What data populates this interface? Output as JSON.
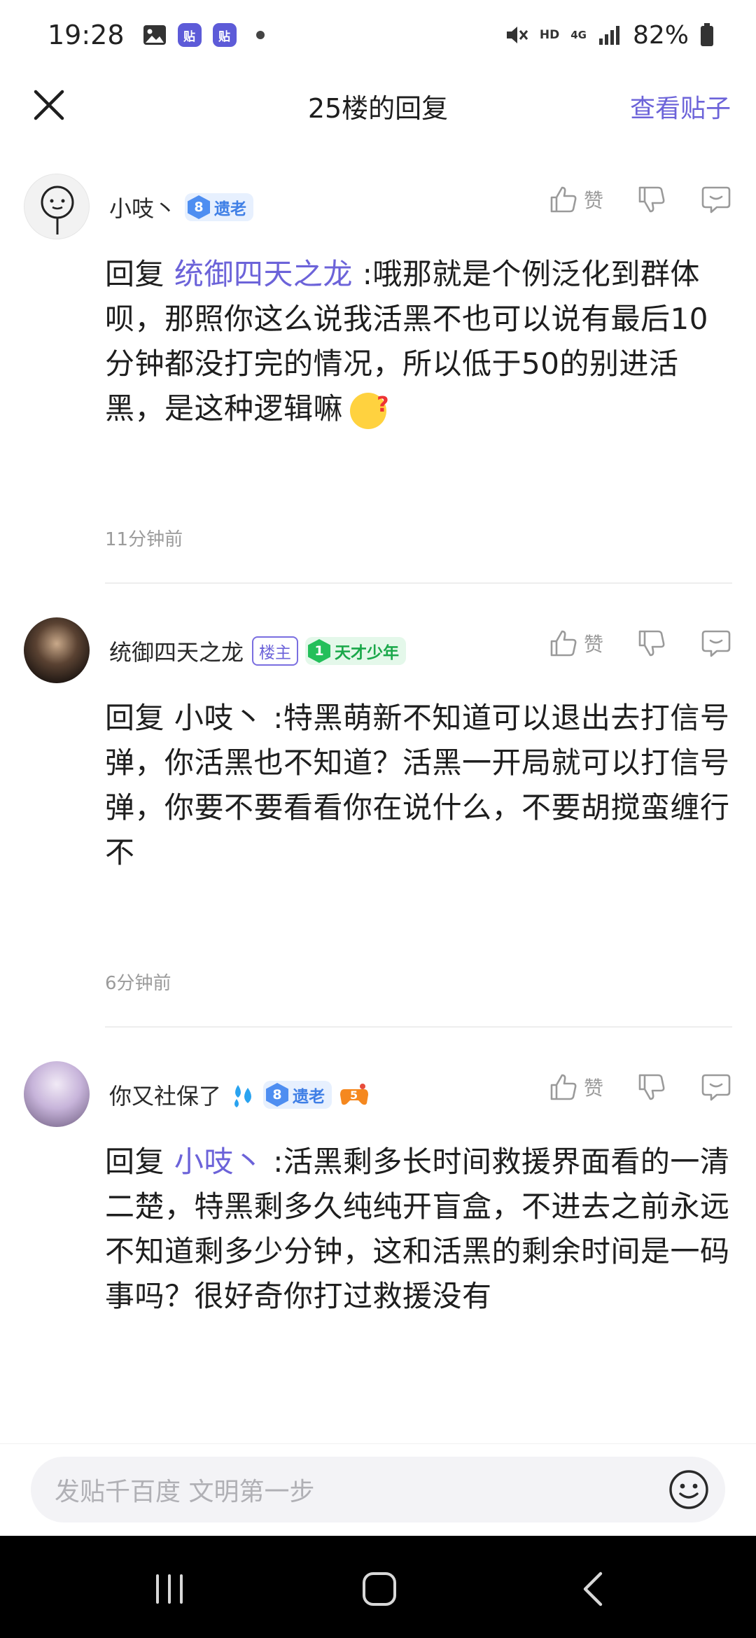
{
  "status_bar": {
    "time": "19:28",
    "tieba_badge_text": "贴",
    "hd": "HD",
    "network": "4G",
    "battery": "82%"
  },
  "header": {
    "title": "25楼的回复",
    "view_post": "查看贴子"
  },
  "actions": {
    "like_label": "赞"
  },
  "comments": [
    {
      "username": "小吱丶",
      "level": "8",
      "level_name": "遗老",
      "reply_prefix": "回复",
      "reply_to": "统御四天之龙",
      "text": ":哦那就是个例泛化到群体呗，那照你这么说我活黑不也可以说有最后10分钟都没打完的情况，所以低于50的别进活黑，是这种逻辑嘛",
      "time": "11分钟前"
    },
    {
      "username": "统御四天之龙",
      "owner_badge": "楼主",
      "level": "1",
      "level_name": "天才少年",
      "reply_prefix": "回复",
      "reply_to": "小吱丶",
      "text": ":特黑萌新不知道可以退出去打信号弹，你活黑也不知道？活黑一开局就可以打信号弹，你要不要看看你在说什么，不要胡搅蛮缠行不",
      "time": "6分钟前"
    },
    {
      "username": "你又社保了",
      "level": "8",
      "level_name": "遗老",
      "reply_prefix": "回复",
      "reply_to": "小吱丶",
      "text": ":活黑剩多长时间救援界面看的一清二楚，特黑剩多久纯纯开盲盒，不进去之前永远不知道剩多少分钟，这和活黑的剩余时间是一码事吗？很好奇你打过救援没有"
    }
  ],
  "input": {
    "placeholder": "发贴千百度 文明第一步"
  },
  "colors": {
    "accent": "#6c63d9",
    "level_blue": "#4e8ef1",
    "level_green": "#23bf5a"
  }
}
